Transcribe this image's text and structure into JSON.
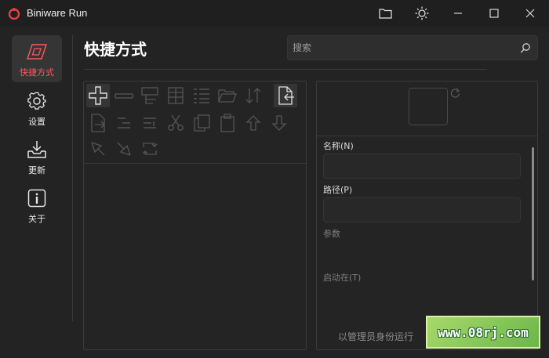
{
  "window": {
    "title": "Biniware Run",
    "accent_color": "#e53f43",
    "buttons": [
      "folder-icon",
      "sun-icon",
      "minimize-icon",
      "maximize-icon",
      "close-icon"
    ]
  },
  "sidebar": {
    "items": [
      {
        "label": "快捷方式",
        "icon": "shortcut-icon",
        "active": true
      },
      {
        "label": "设置",
        "icon": "gear-icon",
        "active": false
      },
      {
        "label": "更新",
        "icon": "download-icon",
        "active": false
      },
      {
        "label": "关于",
        "icon": "info-icon",
        "active": false
      }
    ]
  },
  "main": {
    "title": "快捷方式",
    "search": {
      "placeholder": "搜索",
      "value": ""
    }
  },
  "toolbar": {
    "tools": [
      "add-icon",
      "remove-icon",
      "group-icon",
      "grid-icon",
      "list-icon",
      "open-folder-icon",
      "sort-icon",
      "import-icon",
      "export-icon",
      "indent-icon",
      "outdent-icon",
      "cut-icon",
      "copy-icon",
      "paste-icon",
      "move-up-icon",
      "move-down-icon",
      "expand-icon",
      "collapse-icon",
      "sync-icon"
    ]
  },
  "details": {
    "name_label": "名称(N)",
    "path_label": "路径(P)",
    "args_label": "参数",
    "start_in_label": "启动在(T)",
    "run_as_admin_label": "以管理员身份运行"
  },
  "watermark": {
    "text": "www.08rj.com"
  }
}
